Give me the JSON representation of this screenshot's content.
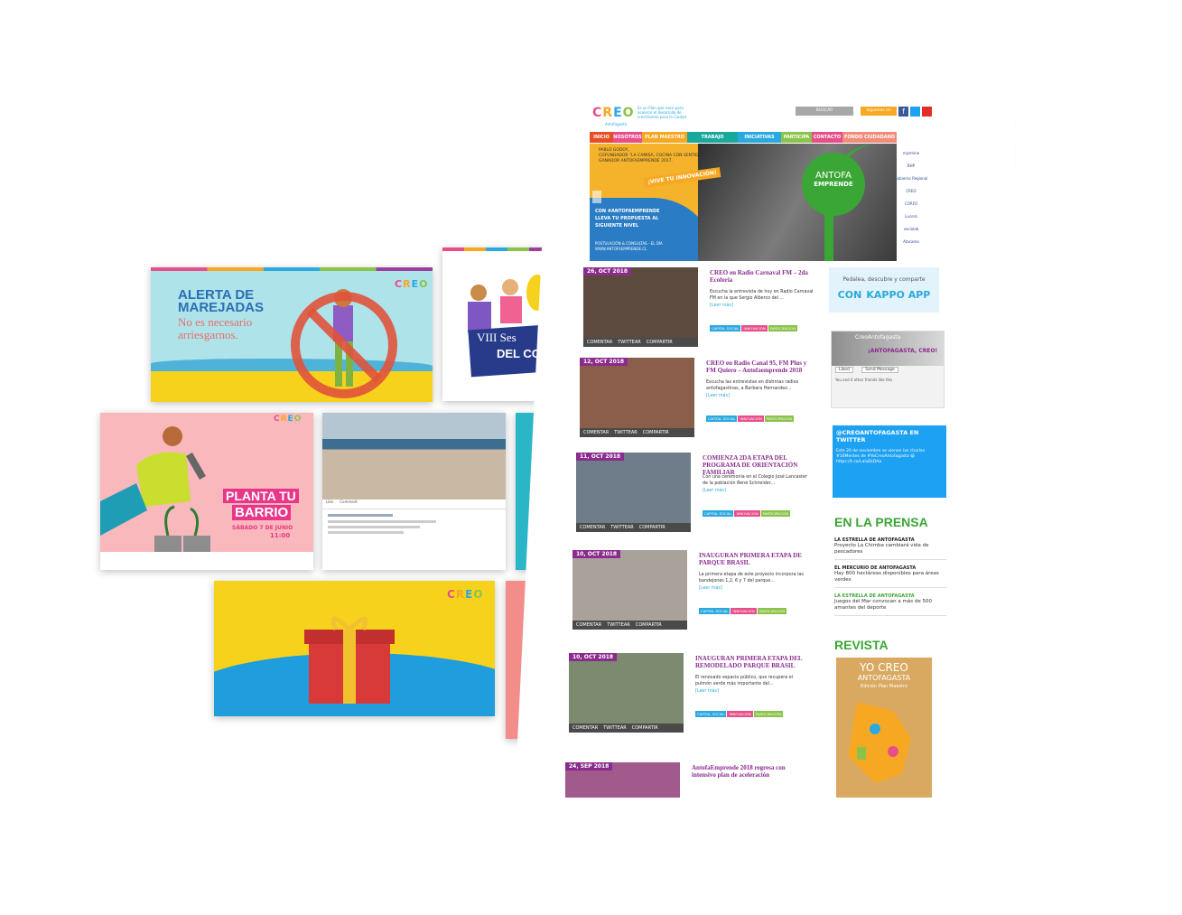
{
  "cards": {
    "marejadas": {
      "title1": "ALERTA DE",
      "title2": "MAREJADAS",
      "subtitle1": "No es necesario",
      "subtitle2": "arriesgarnos."
    },
    "sesion": {
      "line1": "VIII Ses",
      "line2": "DEL CO"
    },
    "planta": {
      "title1": "PLANTA TU",
      "title2": "BARRIO",
      "date": "SÁBADO 7 DE JUNIO",
      "time": "11:00"
    },
    "facebook": {
      "tab1": "Like",
      "tab2": "Comment"
    },
    "creo_logo": [
      "C",
      "R",
      "E",
      "O"
    ]
  },
  "site": {
    "logo_sub": "Antofagasta",
    "tagline": "Es un Plan que nace para acelerar el desarrollo de crecimiento para la Ciudad",
    "search_label": "BUSCAR",
    "follow_label": "Síguenos en",
    "nav": [
      {
        "label": "INICIO",
        "color": "#e84e24"
      },
      {
        "label": "NOSOTROS",
        "color": "#e84e8a"
      },
      {
        "label": "PLAN MAESTRO",
        "color": "#f7a823"
      },
      {
        "label": "TRABAJO CIUDADANO",
        "color": "#1aa79c"
      },
      {
        "label": "INICIATIVAS",
        "color": "#2aa9e0"
      },
      {
        "label": "PARTICIPA",
        "color": "#8bc34a"
      },
      {
        "label": "CONTACTO",
        "color": "#e84e8a"
      },
      {
        "label": "FONDO CIUDADANO",
        "color": "#f28c7a"
      }
    ],
    "hero": {
      "quote1": "PABLO GODOY,",
      "quote2": "COFUNDADOR \"LA CAMISA, COCINA CON SENTIDO\"",
      "quote3": "GANADOR ANTOFAEMPRENDE 2017.",
      "cta": "¡VIVE TU INNOVACIÓN!",
      "brand1": "ANTOFA",
      "brand2": "EMPRENDE",
      "body1": "CON #ANTOFAEMPRENDE",
      "body2": "LLEVA TU PROPUESTA AL",
      "body3": "SIGUIENTE NIVEL",
      "foot1": "POSTULACIÓN & CONSULTAS - EL DÍA",
      "foot2": "WWW.ANTOFAEMPRENDE.CL",
      "sponsors": [
        "mysmine",
        "BHP",
        "Gobierno Regional",
        "CREO",
        "CORFO",
        "Lucera",
        "socialab",
        "Atacama"
      ]
    },
    "posts": [
      {
        "date": "26, OCT 2018",
        "title": "CREO en Radio Carnaval FM – 2da Ecoferia",
        "excerpt": "Escucha la entrevista de hoy en Radio Carnaval FM en la que Sergio Alberco del …",
        "more": "[Leer más]"
      },
      {
        "date": "12, OCT 2018",
        "title": "CREO en Radio Canal 95, FM Plus y FM Quiero – Antofaemprende 2018",
        "excerpt": "Escucha las entrevistas en distintas radios antofagastinas, a Barbara Hernandez…",
        "more": "[Leer más]"
      },
      {
        "date": "11, OCT 2018",
        "title": "COMIENZA 2DA ETAPA DEL PROGRAMA DE ORIENTACIÓN FAMILIAR",
        "excerpt": "Con una ceremonia en el Colegio José Lancaster de la población René Schneider…",
        "more": "[Leer más]"
      },
      {
        "date": "10, OCT 2018",
        "title": "INAUGURAN PRIMERA ETAPA DE PARQUE BRASIL",
        "excerpt": "La primera etapa de este proyecto incorpora las bandejones 1,2, 6 y 7 del parque…",
        "more": "[Leer más]"
      },
      {
        "date": "10, OCT 2018",
        "title": "INAUGURAN PRIMERA ETAPA DEL REMODELADO PARQUE BRASIL",
        "excerpt": "El renovado espacio público, que recupera el pulmón verde más importante del…",
        "more": "[Leer más]"
      },
      {
        "date": "24, SEP 2018",
        "title": "AntofaEmprende 2018 regresa con intensivo plan de aceleración",
        "excerpt": "",
        "more": ""
      }
    ],
    "tags": [
      {
        "label": "CAPITAL SOCIAL",
        "color": "#2aa9e0"
      },
      {
        "label": "INNOVACIÓN",
        "color": "#e84e8a"
      },
      {
        "label": "PARTICIPACIÓN",
        "color": "#8bc34a"
      }
    ],
    "share": {
      "comment": "COMENTAR",
      "twitter": "TWITTEAR",
      "share": "COMPARTIR"
    },
    "kappo": {
      "line1": "Pedalea, descubre y comparte",
      "line2": "CON",
      "line3": "KAPPO APP"
    },
    "fb_box": {
      "name": "CreoAntofagasta",
      "banner": "¡ANTOFAGASTA, CREO!",
      "liked": "Liked",
      "send": "Send Message",
      "friends": "You and 4 other friends like this"
    },
    "twitter_box": {
      "title": "@CREOANTOFAGASTA EN TWITTER",
      "text": "Este 20 de noviembre se vienen las charlas #10Mentes de #YoCreoAntofagasta 😀 https://t.co/LaluEkDAa"
    },
    "press": {
      "title": "EN LA PRENSA",
      "items": [
        {
          "source": "LA ESTRELLA DE ANTOFAGASTA",
          "text": "Proyecto La Chimba cambiará vida de pescadores",
          "color": "#222"
        },
        {
          "source": "EL MERCURIO DE ANTOFAGASTA",
          "text": "Hay 800 hectáreas disponibles para áreas verdes",
          "color": "#222"
        },
        {
          "source": "LA ESTRELLA DE ANTOFAGASTA",
          "text": "Juegos del Mar convocan a más de 500 amantes del deporte",
          "color": "#3aa635"
        }
      ]
    },
    "revista": {
      "title": "REVISTA",
      "cover1": "YO CREO",
      "cover2": "ANTOFAGASTA",
      "cover3": "Edición Plan Maestro"
    }
  }
}
